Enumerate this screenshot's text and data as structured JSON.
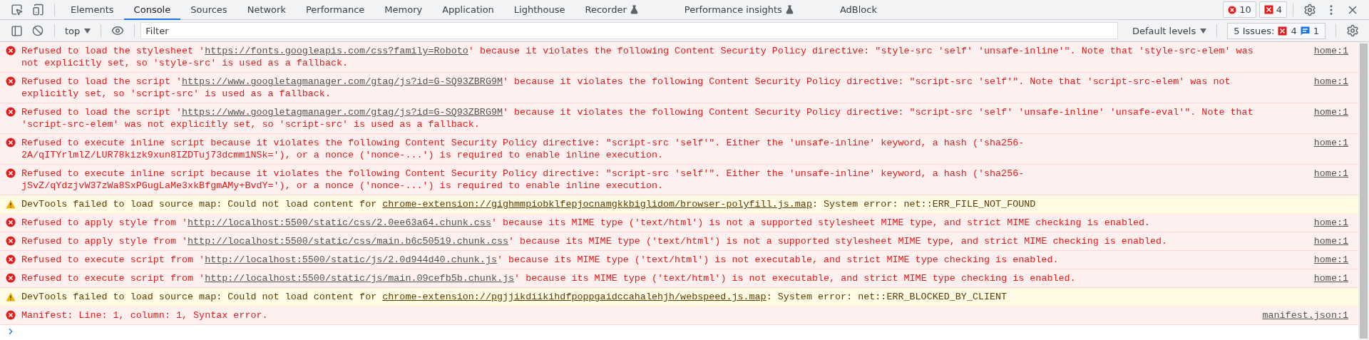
{
  "toolbar": {
    "tabs": [
      {
        "label": "Elements",
        "selected": false,
        "experimental": false
      },
      {
        "label": "Console",
        "selected": true,
        "experimental": false
      },
      {
        "label": "Sources",
        "selected": false,
        "experimental": false
      },
      {
        "label": "Network",
        "selected": false,
        "experimental": false
      },
      {
        "label": "Performance",
        "selected": false,
        "experimental": false
      },
      {
        "label": "Memory",
        "selected": false,
        "experimental": false
      },
      {
        "label": "Application",
        "selected": false,
        "experimental": false
      },
      {
        "label": "Lighthouse",
        "selected": false,
        "experimental": false
      },
      {
        "label": "Recorder",
        "selected": false,
        "experimental": true
      },
      {
        "label": "Performance insights",
        "selected": false,
        "experimental": true
      },
      {
        "label": "AdBlock",
        "selected": false,
        "experimental": false
      }
    ],
    "error_count": "10",
    "issue_count": "4"
  },
  "console_bar": {
    "context": "top",
    "filter": {
      "placeholder": "Filter"
    },
    "levels": "Default levels",
    "issues": {
      "label": "5 Issues:",
      "errors": "4",
      "info": "1"
    }
  },
  "messages": [
    {
      "kind": "error",
      "text": "Refused to load the stylesheet '",
      "link": "https://fonts.googleapis.com/css?family=Roboto",
      "after": "' because it violates the following Content Security Policy directive: \"style-src 'self' 'unsafe-inline'\". Note that 'style-src-elem' was not explicitly set, so 'style-src' is used as a fallback.",
      "source": "home:1"
    },
    {
      "kind": "error",
      "text": "Refused to load the script '",
      "link": "https://www.googletagmanager.com/gtag/js?id=G-SQ93ZBRG9M",
      "after": "' because it violates the following Content Security Policy directive: \"script-src 'self'\". Note that 'script-src-elem' was not explicitly set, so 'script-src' is used as a fallback.",
      "source": "home:1"
    },
    {
      "kind": "error",
      "text": "Refused to load the script '",
      "link": "https://www.googletagmanager.com/gtag/js?id=G-SQ93ZBRG9M",
      "after": "' because it violates the following Content Security Policy directive: \"script-src 'self' 'unsafe-inline' 'unsafe-eval'\". Note that 'script-src-elem' was not explicitly set, so 'script-src' is used as a fallback.",
      "source": "home:1"
    },
    {
      "kind": "error",
      "text": "Refused to execute inline script because it violates the following Content Security Policy directive: \"script-src 'self'\". Either the 'unsafe-inline' keyword, a hash ('sha256-2A/qITYrlmlZ/LUR78kizk9xun8IZDTuj73dcmm1NSk='), or a nonce ('nonce-...') is required to enable inline execution.",
      "source": "home:1"
    },
    {
      "kind": "error",
      "text": "Refused to execute inline script because it violates the following Content Security Policy directive: \"script-src 'self'\". Either the 'unsafe-inline' keyword, a hash ('sha256-jSvZ/qYdzjvW37zWa8SxPGugLaMe3xkBfgmAMy+BvdY='), or a nonce ('nonce-...') is required to enable inline execution.",
      "source": "home:1"
    },
    {
      "kind": "warning",
      "text": "DevTools failed to load source map: Could not load content for ",
      "link": "chrome-extension://gighmmpiobklfepjocnamgkkbiglidom/browser-polyfill.js.map",
      "after": ": System error: net::ERR_FILE_NOT_FOUND"
    },
    {
      "kind": "error",
      "text": "Refused to apply style from '",
      "link": "http://localhost:5500/static/css/2.0ee63a64.chunk.css",
      "after": "' because its MIME type ('text/html') is not a supported stylesheet MIME type, and strict MIME checking is enabled.",
      "source": "home:1"
    },
    {
      "kind": "error",
      "text": "Refused to apply style from '",
      "link": "http://localhost:5500/static/css/main.b6c50519.chunk.css",
      "after": "' because its MIME type ('text/html') is not a supported stylesheet MIME type, and strict MIME checking is enabled.",
      "source": "home:1"
    },
    {
      "kind": "error",
      "text": "Refused to execute script from '",
      "link": "http://localhost:5500/static/js/2.0d944d40.chunk.js",
      "after": "' because its MIME type ('text/html') is not executable, and strict MIME type checking is enabled.",
      "source": "home:1"
    },
    {
      "kind": "error",
      "text": "Refused to execute script from '",
      "link": "http://localhost:5500/static/js/main.09cefb5b.chunk.js",
      "after": "' because its MIME type ('text/html') is not executable, and strict MIME type checking is enabled.",
      "source": "home:1"
    },
    {
      "kind": "warning",
      "text": "DevTools failed to load source map: Could not load content for ",
      "link": "chrome-extension://pgjjikdiikihdfpoppgaidccahalehjh/webspeed.js.map",
      "after": ": System error: net::ERR_BLOCKED_BY_CLIENT"
    },
    {
      "kind": "error",
      "text": "Manifest: Line: 1, column: 1, Syntax error.",
      "source": "manifest.json:1"
    }
  ]
}
